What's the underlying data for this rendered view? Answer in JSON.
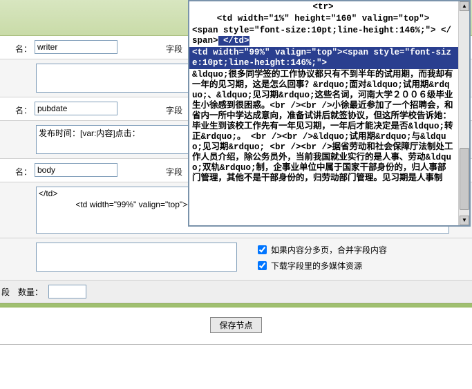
{
  "labels": {
    "name": "名：",
    "field": "字段",
    "count_prefix": "段",
    "count_label": "数量：",
    "save_button": "保存节点"
  },
  "fields": {
    "writer": {
      "value": "writer",
      "content": ""
    },
    "pubdate": {
      "value": "pubdate",
      "content": "发布时间：[var:内容]点击："
    },
    "body": {
      "value": "body",
      "content": "</td>\n                <td width=\"99%\" valign=\"top\"><span style=\"font-size:10pt;line-height:146%;\">[var:内容]"
    }
  },
  "options": {
    "merge": {
      "checked": true,
      "label": "如果内容分多页，合并字段内容"
    },
    "download": {
      "checked": true,
      "label": "下载字段里的多媒体资源"
    }
  },
  "count_value": "",
  "overlay": {
    "line1": "<tr>",
    "line2": "    <td width=\"1%\" height=\"160\" valign=\"top\">",
    "line3": "          <span style=\"font-size:10pt;line-height:146%;\"> </span>",
    "sel1": " </td>",
    "sel2": "              <td width=\"99%\" valign=\"top\"><span style=\"font-size:10pt;line-height:146%;\">",
    "prose": "              &ldquo;很多同学签的工作协议都只有不到半年的试用期，而我却有一年的见习期，这是怎么回事？&rdquo;面对&ldquo;试用期&rdquo;、&ldquo;见习期&rdquo;这些名词，河南大学２００６级毕业生小徐感到很困惑。<br /><br />小徐最近参加了一个招聘会，和省内一所中学达成意向，准备试讲后就签协议，但这所学校告诉她：毕业生到该校工作先有一年见习期，一年后才能决定是否&ldquo;转正&rdquo;。  <br /><br />&ldquo;试用期&rdquo;与&ldquo;见习期&rdquo;  <br /><br />据省劳动和社会保障厅法制处工作人员介绍，除公务员外，当前我国就业实行的是人事、劳动&ldquo;双轨&rdquo;制，企事业单位中属于国家干部身份的，归人事部门管理，其他不是干部身份的，归劳动部门管理。见习期是人事制"
  }
}
